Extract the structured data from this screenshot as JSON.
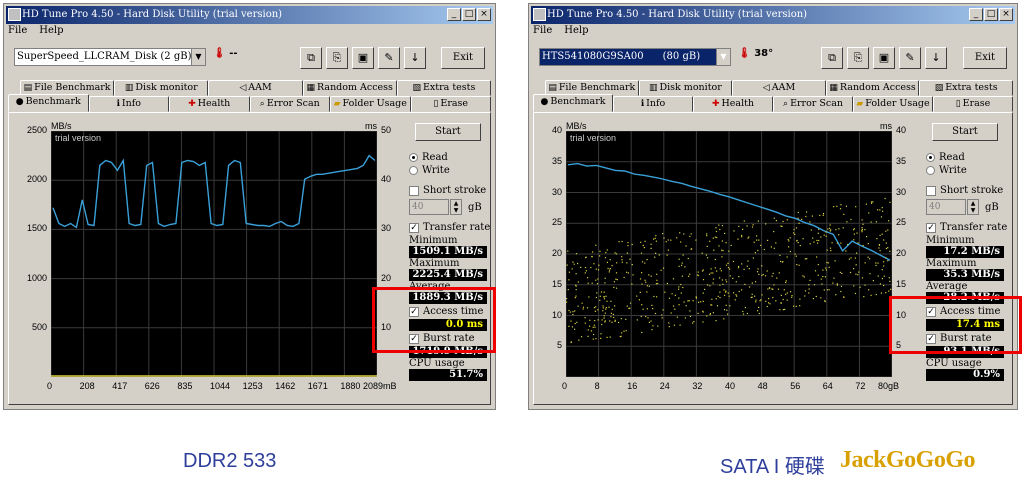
{
  "windows": [
    {
      "title": "HD Tune Pro 4.50 - Hard Disk Utility (trial version)",
      "menu": [
        "File",
        "Help"
      ],
      "drive": "SuperSpeed_LLCRAM_Disk (2 gB)",
      "temperature": "--",
      "exit_label": "Exit",
      "tabs_row1": [
        "File Benchmark",
        "Disk monitor",
        "AAM",
        "Random Access",
        "Extra tests"
      ],
      "tabs_row2": [
        "Benchmark",
        "Info",
        "Health",
        "Error Scan",
        "Folder Usage",
        "Erase"
      ],
      "active_tab": "Benchmark",
      "chart_data": {
        "type": "line",
        "watermark": "trial version",
        "left_axis_unit": "MB/s",
        "right_axis_unit": "ms",
        "left_ticks": [
          "2500",
          "2000",
          "1500",
          "1000",
          "500",
          ""
        ],
        "right_ticks": [
          "50",
          "40",
          "30",
          "20",
          "10",
          ""
        ],
        "x_ticks": [
          "0",
          "208",
          "417",
          "626",
          "835",
          "1044",
          "1253",
          "1462",
          "1671",
          "1880",
          "2089mB"
        ],
        "ylim": [
          0,
          2500
        ],
        "xlim": [
          0,
          2089
        ],
        "transfer_series": [
          1720,
          1560,
          1530,
          1560,
          1520,
          1800,
          1550,
          1540,
          2150,
          2200,
          2180,
          2100,
          2200,
          1560,
          1540,
          1550,
          2150,
          2180,
          1560,
          1530,
          1550,
          1560,
          2180,
          2200,
          2190,
          2150,
          2180,
          1560,
          1540,
          1550,
          2150,
          2200,
          2180,
          1560,
          1550,
          1540,
          1540,
          1530,
          1560,
          1580,
          1540,
          1530,
          1560,
          2010,
          2040,
          2060,
          2060,
          2070,
          2080,
          2090,
          2100,
          2110,
          2120,
          2150,
          2250,
          2200
        ],
        "access_time_ms": 0.0
      },
      "controls": {
        "start_label": "Start",
        "read_label": "Read",
        "write_label": "Write",
        "short_stroke_label": "Short stroke",
        "stroke_value": "40",
        "stroke_unit": "gB",
        "transfer_rate_label": "Transfer rate",
        "access_time_label": "Access time",
        "burst_label": "Burst rate",
        "cpu_label": "CPU usage"
      },
      "stats": {
        "minimum_label": "Minimum",
        "minimum": "1509.1 MB/s",
        "maximum_label": "Maximum",
        "maximum": "2225.4 MB/s",
        "average_label": "Average",
        "average": "1889.3 MB/s",
        "access_time": "0.0 ms",
        "burst_rate": "1719.9 MB/s",
        "cpu_usage": "51.7%"
      },
      "caption": "DDR2 533"
    },
    {
      "title": "HD Tune Pro 4.50 - Hard Disk Utility (trial version)",
      "menu": [
        "File",
        "Help"
      ],
      "drive": "HTS541080G9SA00      (80 gB)",
      "temperature": "38°",
      "exit_label": "Exit",
      "tabs_row1": [
        "File Benchmark",
        "Disk monitor",
        "AAM",
        "Random Access",
        "Extra tests"
      ],
      "tabs_row2": [
        "Benchmark",
        "Info",
        "Health",
        "Error Scan",
        "Folder Usage",
        "Erase"
      ],
      "active_tab": "Benchmark",
      "chart_data": {
        "type": "line",
        "watermark": "trial version",
        "left_axis_unit": "MB/s",
        "right_axis_unit": "ms",
        "left_ticks": [
          "40",
          "35",
          "30",
          "25",
          "20",
          "15",
          "10",
          "5",
          ""
        ],
        "right_ticks": [
          "40",
          "35",
          "30",
          "25",
          "20",
          "15",
          "10",
          "5",
          ""
        ],
        "x_ticks": [
          "0",
          "8",
          "16",
          "24",
          "32",
          "40",
          "48",
          "56",
          "64",
          "72",
          "80gB"
        ],
        "ylim": [
          0,
          40
        ],
        "xlim": [
          0,
          80
        ],
        "transfer_series": [
          34.5,
          34.7,
          34.3,
          34.4,
          34.0,
          33.6,
          33.5,
          33.0,
          32.8,
          32.5,
          32.2,
          31.8,
          31.5,
          31.0,
          30.6,
          30.2,
          29.7,
          29.3,
          28.8,
          28.3,
          27.8,
          27.3,
          26.8,
          26.2,
          25.8,
          25.1,
          24.6,
          23.8,
          23.2,
          20.5,
          22.1,
          21.3,
          20.6,
          19.8,
          19.0
        ],
        "access_time_ms": 17.4
      },
      "controls": {
        "start_label": "Start",
        "read_label": "Read",
        "write_label": "Write",
        "short_stroke_label": "Short stroke",
        "stroke_value": "40",
        "stroke_unit": "gB",
        "transfer_rate_label": "Transfer rate",
        "access_time_label": "Access time",
        "burst_label": "Burst rate",
        "cpu_label": "CPU usage"
      },
      "stats": {
        "minimum_label": "Minimum",
        "minimum": "17.2 MB/s",
        "maximum_label": "Maximum",
        "maximum": "35.3 MB/s",
        "average_label": "Average",
        "average": "28.2 MB/s",
        "access_time": "17.4 ms",
        "burst_rate": "93.1 MB/s",
        "cpu_usage": "0.9%"
      },
      "caption": "SATA I 硬碟"
    }
  ],
  "watermark_brand": "JackGoGoGo",
  "colors": {
    "highlight": "#e00000",
    "transfer_line": "#3aa0d8",
    "access_dots": "#d8d040",
    "grid": "#3a3a3a"
  }
}
